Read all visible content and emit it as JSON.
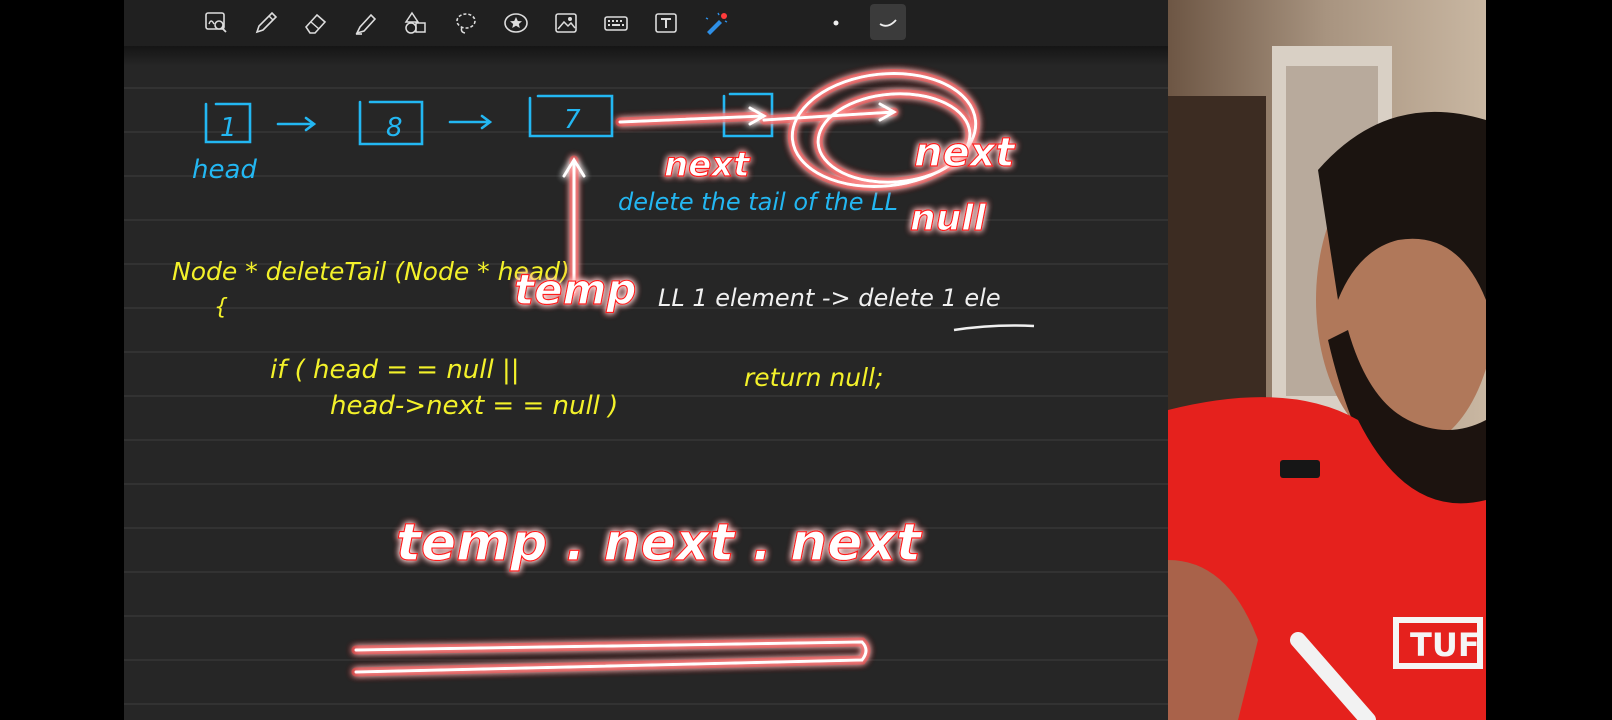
{
  "toolbar": {
    "tools": [
      {
        "name": "zoom-tool",
        "icon": "zoom-icon"
      },
      {
        "name": "pen-tool",
        "icon": "pen-icon"
      },
      {
        "name": "eraser-tool",
        "icon": "eraser-icon"
      },
      {
        "name": "highlighter-tool",
        "icon": "highlighter-icon"
      },
      {
        "name": "shapes-tool",
        "icon": "shapes-icon"
      },
      {
        "name": "lasso-tool",
        "icon": "lasso-icon"
      },
      {
        "name": "sticker-tool",
        "icon": "star-icon"
      },
      {
        "name": "image-tool",
        "icon": "image-icon"
      },
      {
        "name": "keyboard-tool",
        "icon": "keyboard-icon"
      },
      {
        "name": "text-tool",
        "icon": "text-box-icon"
      },
      {
        "name": "laser-pointer-tool",
        "icon": "laser-pointer-icon"
      },
      {
        "name": "pen-size-dot",
        "icon": "dot-icon"
      },
      {
        "name": "stroke-style",
        "icon": "stroke-icon"
      }
    ],
    "active_tool": "stroke-style"
  },
  "notes": {
    "diagram": {
      "nodes": [
        "1",
        "8",
        "7"
      ],
      "head_label": "head",
      "next_label_1": "next",
      "next_label_2": "next",
      "null_label": "null",
      "delete_note": "delete the tail of the LL"
    },
    "code": {
      "signature": "Node * deleteTail (Node * head)",
      "brace": "{",
      "temp_label": "temp",
      "if_line_1": "if ( head = = null ||",
      "if_line_2": "head->next = = null )",
      "return_stmt": "return null;",
      "one_element_note": "LL 1 element -> delete 1 ele",
      "temp_expr": "temp . next . next"
    }
  },
  "colors": {
    "canvas": "#262626",
    "blue_ink": "#23b7f2",
    "yellow_ink": "#f3f12a",
    "white_ink": "#f0f0f0",
    "red_glow": "#ff1d1d"
  }
}
